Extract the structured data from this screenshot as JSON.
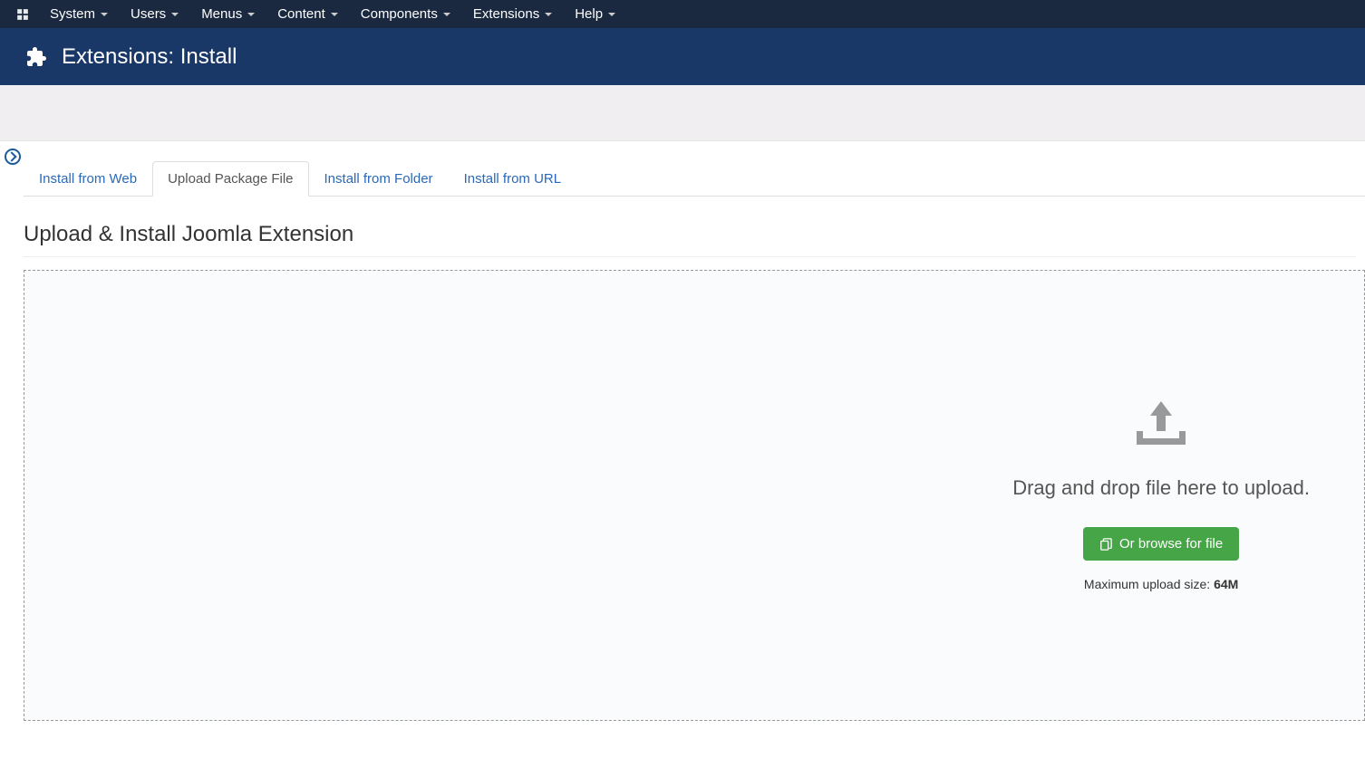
{
  "nav": {
    "items": [
      "System",
      "Users",
      "Menus",
      "Content",
      "Components",
      "Extensions",
      "Help"
    ]
  },
  "header": {
    "title": "Extensions: Install"
  },
  "tabs": {
    "items": [
      {
        "label": "Install from Web",
        "active": false
      },
      {
        "label": "Upload Package File",
        "active": true
      },
      {
        "label": "Install from Folder",
        "active": false
      },
      {
        "label": "Install from URL",
        "active": false
      }
    ]
  },
  "section": {
    "title": "Upload & Install Joomla Extension"
  },
  "upload": {
    "drag_text": "Drag and drop file here to upload.",
    "browse_label": "Or browse for file",
    "max_size_label": "Maximum upload size: ",
    "max_size_value": "64M"
  }
}
